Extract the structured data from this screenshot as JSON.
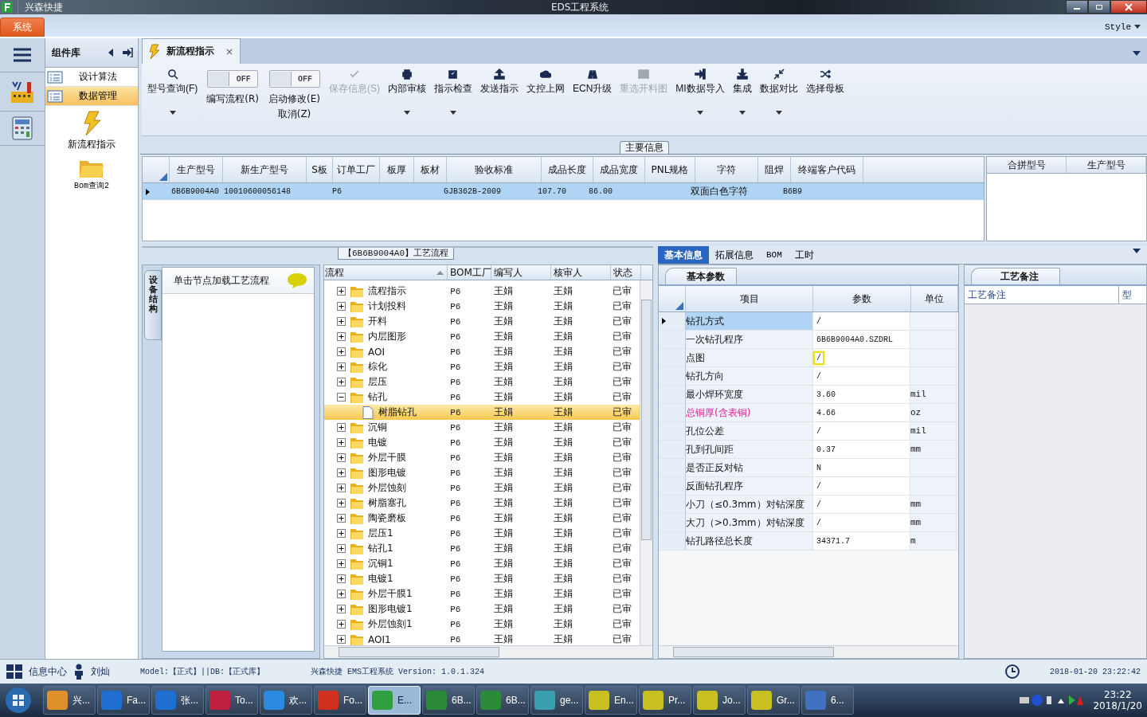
{
  "window": {
    "app_name": "兴森快捷",
    "title": "EDS工程系统"
  },
  "menu": {
    "items": [
      {
        "label": "系统",
        "selected": true
      }
    ],
    "style_label": "Style"
  },
  "nav_strip": {
    "icons": [
      {
        "kind": "menu"
      },
      {
        "kind": "factory"
      },
      {
        "kind": "calculator"
      }
    ]
  },
  "component_panel": {
    "title": "组件库",
    "items": [
      {
        "label": "设计算法",
        "selected": false
      },
      {
        "label": "数据管理",
        "selected": true
      }
    ],
    "tools": [
      {
        "label": "新流程指示",
        "kind": "lightning"
      },
      {
        "label": "Bom查询2",
        "kind": "folder"
      }
    ]
  },
  "document_tab": {
    "label": "新流程指示",
    "close": "×"
  },
  "toolbar": [
    {
      "kind": "button",
      "label": "型号查询(F)",
      "disabled": false,
      "dropdown": true
    },
    {
      "kind": "toggle",
      "state_text": "OFF",
      "on": false,
      "label": "编写流程(R)"
    },
    {
      "kind": "toggle",
      "state_text": "OFF",
      "on": false,
      "label": "启动修改(E)",
      "label2": "取消(Z)"
    },
    {
      "kind": "button",
      "label": "保存信息(S)",
      "disabled": true,
      "dropdown": false
    },
    {
      "kind": "button",
      "label": "内部审核",
      "disabled": false,
      "dropdown": true
    },
    {
      "kind": "button",
      "label": "指示检查",
      "disabled": false,
      "dropdown": true
    },
    {
      "kind": "button",
      "label": "发送指示",
      "disabled": false,
      "dropdown": false
    },
    {
      "kind": "button",
      "label": "文控上网",
      "disabled": false,
      "dropdown": false
    },
    {
      "kind": "button",
      "label": "ECN升级",
      "disabled": false,
      "dropdown": false
    },
    {
      "kind": "button",
      "label": "重选开料图",
      "disabled": true,
      "dropdown": false
    },
    {
      "kind": "button",
      "label": "MI数据导入",
      "disabled": false,
      "dropdown": true
    },
    {
      "kind": "button",
      "label": "集成",
      "disabled": false,
      "dropdown": true
    },
    {
      "kind": "button",
      "label": "数据对比",
      "disabled": false,
      "dropdown": true
    },
    {
      "kind": "button",
      "label": "选择母板",
      "disabled": false,
      "dropdown": false
    }
  ],
  "main_info": {
    "title": "主要信息",
    "columns": [
      "生产型号",
      "新生产型号",
      "S板",
      "订单工厂",
      "板厚",
      "板材",
      "验收标准",
      "成品长度",
      "成品宽度",
      "PNL规格",
      "字符",
      "阻焊",
      "终端客户代码"
    ],
    "rows": [
      {
        "selected": true,
        "cells": [
          "6B6B9004A0",
          "10010600056148",
          "",
          "P6",
          "",
          "",
          "GJB362B-2009",
          "107.70",
          "86.00",
          "",
          "双面白色字符",
          "",
          "B6B9"
        ]
      }
    ],
    "side_columns": [
      "合拼型号",
      "生产型号"
    ]
  },
  "process": {
    "title": "【6B6B9004A0】工艺流程",
    "side_tab": "设备结构",
    "hint": "单击节点加载工艺流程",
    "columns": [
      "流程",
      "BOM工厂",
      "编写人",
      "核审人",
      "状态"
    ],
    "nodes": [
      {
        "label": "流程指示",
        "bom": "P6",
        "writer": "王娟",
        "reviewer": "王娟",
        "status": "已审",
        "expanded": false,
        "selected": false
      },
      {
        "label": "计划投料",
        "bom": "P6",
        "writer": "王娟",
        "reviewer": "王娟",
        "status": "已审",
        "expanded": false,
        "selected": false
      },
      {
        "label": "开料",
        "bom": "P6",
        "writer": "王娟",
        "reviewer": "王娟",
        "status": "已审",
        "expanded": false,
        "selected": false
      },
      {
        "label": "内层图形",
        "bom": "P6",
        "writer": "王娟",
        "reviewer": "王娟",
        "status": "已审",
        "expanded": false,
        "selected": false
      },
      {
        "label": "AOI",
        "bom": "P6",
        "writer": "王娟",
        "reviewer": "王娟",
        "status": "已审",
        "expanded": false,
        "selected": false
      },
      {
        "label": "棕化",
        "bom": "P6",
        "writer": "王娟",
        "reviewer": "王娟",
        "status": "已审",
        "expanded": false,
        "selected": false
      },
      {
        "label": "层压",
        "bom": "P6",
        "writer": "王娟",
        "reviewer": "王娟",
        "status": "已审",
        "expanded": false,
        "selected": false
      },
      {
        "label": "钻孔",
        "bom": "P6",
        "writer": "王娟",
        "reviewer": "王娟",
        "status": "已审",
        "expanded": true,
        "selected": false,
        "children": [
          {
            "label": "树脂钻孔",
            "bom": "P6",
            "writer": "王娟",
            "reviewer": "王娟",
            "status": "已审",
            "selected": true
          }
        ]
      },
      {
        "label": "沉铜",
        "bom": "P6",
        "writer": "王娟",
        "reviewer": "王娟",
        "status": "已审",
        "expanded": false,
        "selected": false
      },
      {
        "label": "电镀",
        "bom": "P6",
        "writer": "王娟",
        "reviewer": "王娟",
        "status": "已审",
        "expanded": false,
        "selected": false
      },
      {
        "label": "外层干膜",
        "bom": "P6",
        "writer": "王娟",
        "reviewer": "王娟",
        "status": "已审",
        "expanded": false,
        "selected": false
      },
      {
        "label": "图形电镀",
        "bom": "P6",
        "writer": "王娟",
        "reviewer": "王娟",
        "status": "已审",
        "expanded": false,
        "selected": false
      },
      {
        "label": "外层蚀刻",
        "bom": "P6",
        "writer": "王娟",
        "reviewer": "王娟",
        "status": "已审",
        "expanded": false,
        "selected": false
      },
      {
        "label": "树脂塞孔",
        "bom": "P6",
        "writer": "王娟",
        "reviewer": "王娟",
        "status": "已审",
        "expanded": false,
        "selected": false
      },
      {
        "label": "陶瓷磨板",
        "bom": "P6",
        "writer": "王娟",
        "reviewer": "王娟",
        "status": "已审",
        "expanded": false,
        "selected": false
      },
      {
        "label": "层压1",
        "bom": "P6",
        "writer": "王娟",
        "reviewer": "王娟",
        "status": "已审",
        "expanded": false,
        "selected": false
      },
      {
        "label": "钻孔1",
        "bom": "P6",
        "writer": "王娟",
        "reviewer": "王娟",
        "status": "已审",
        "expanded": false,
        "selected": false
      },
      {
        "label": "沉铜1",
        "bom": "P6",
        "writer": "王娟",
        "reviewer": "王娟",
        "status": "已审",
        "expanded": false,
        "selected": false
      },
      {
        "label": "电镀1",
        "bom": "P6",
        "writer": "王娟",
        "reviewer": "王娟",
        "status": "已审",
        "expanded": false,
        "selected": false
      },
      {
        "label": "外层干膜1",
        "bom": "P6",
        "writer": "王娟",
        "reviewer": "王娟",
        "status": "已审",
        "expanded": false,
        "selected": false
      },
      {
        "label": "图形电镀1",
        "bom": "P6",
        "writer": "王娟",
        "reviewer": "王娟",
        "status": "已审",
        "expanded": false,
        "selected": false
      },
      {
        "label": "外层蚀刻1",
        "bom": "P6",
        "writer": "王娟",
        "reviewer": "王娟",
        "status": "已审",
        "expanded": false,
        "selected": false
      },
      {
        "label": "AOI1",
        "bom": "P6",
        "writer": "王娟",
        "reviewer": "王娟",
        "status": "已审",
        "expanded": false,
        "selected": false
      }
    ]
  },
  "detail": {
    "tabs": [
      {
        "label": "基本信息",
        "selected": true
      },
      {
        "label": "拓展信息",
        "selected": false
      },
      {
        "label": "BOM",
        "selected": false
      },
      {
        "label": "工时",
        "selected": false
      }
    ],
    "sub_tab": "基本参数",
    "columns": [
      "项目",
      "参数",
      "单位"
    ],
    "rows": [
      {
        "item": "钻孔方式",
        "value": "/",
        "unit": "",
        "selected": true,
        "focused": false,
        "emphasis": false
      },
      {
        "item": "一次钻孔程序",
        "value": "6B6B9004A0.SZDRL",
        "unit": "",
        "selected": false,
        "focused": false,
        "emphasis": false
      },
      {
        "item": "点图",
        "value": "/",
        "unit": "",
        "selected": false,
        "focused": true,
        "emphasis": false
      },
      {
        "item": "钻孔方向",
        "value": "/",
        "unit": "",
        "selected": false,
        "focused": false,
        "emphasis": false
      },
      {
        "item": "最小焊环宽度",
        "value": "3.60",
        "unit": "mil",
        "selected": false,
        "focused": false,
        "emphasis": false
      },
      {
        "item": "总铜厚(含表铜)",
        "value": "4.66",
        "unit": "oz",
        "selected": false,
        "focused": false,
        "emphasis": true
      },
      {
        "item": "孔位公差",
        "value": "/",
        "unit": "mil",
        "selected": false,
        "focused": false,
        "emphasis": false
      },
      {
        "item": "孔到孔间距",
        "value": "0.37",
        "unit": "mm",
        "selected": false,
        "focused": false,
        "emphasis": false
      },
      {
        "item": "是否正反对钻",
        "value": "N",
        "unit": "",
        "selected": false,
        "focused": false,
        "emphasis": false
      },
      {
        "item": "反面钻孔程序",
        "value": "/",
        "unit": "",
        "selected": false,
        "focused": false,
        "emphasis": false
      },
      {
        "item": "小刀（≤0.3mm）对钻深度",
        "value": "/",
        "unit": "mm",
        "selected": false,
        "focused": false,
        "emphasis": false
      },
      {
        "item": "大刀（>0.3mm）对钻深度",
        "value": "/",
        "unit": "mm",
        "selected": false,
        "focused": false,
        "emphasis": false
      },
      {
        "item": "钻孔路径总长度",
        "value": "34371.7",
        "unit": "m",
        "selected": false,
        "focused": false,
        "emphasis": false
      }
    ]
  },
  "notes": {
    "tab": "工艺备注",
    "columns": [
      "工艺备注",
      "型"
    ]
  },
  "status_bar": {
    "info_center": "信息中心",
    "user": "刘灿",
    "model": "Model:【正式】||DB:【正式库】",
    "version": "兴森快捷 EMS工程系统 Version: 1.0.1.324",
    "datetime": "2018-01-20 23:22:42"
  },
  "taskbar": {
    "items": [
      {
        "label": "兴...",
        "color": "#e0902a",
        "selected": false
      },
      {
        "label": "Fa...",
        "color": "#1f6fd0",
        "selected": false
      },
      {
        "label": "张...",
        "color": "#1f6fd0",
        "selected": false
      },
      {
        "label": "To...",
        "color": "#c02040",
        "selected": false
      },
      {
        "label": "欢...",
        "color": "#2a8ae0",
        "selected": false
      },
      {
        "label": "Fo...",
        "color": "#d03020",
        "selected": false
      },
      {
        "label": "E...",
        "color": "#30a040",
        "selected": true
      },
      {
        "label": "6B...",
        "color": "#2a8a3a",
        "selected": false
      },
      {
        "label": "6B...",
        "color": "#2a8a3a",
        "selected": false
      },
      {
        "label": "ge...",
        "color": "#3aa0b0",
        "selected": false
      },
      {
        "label": "En...",
        "color": "#c8c020",
        "selected": false
      },
      {
        "label": "Pr...",
        "color": "#c8c020",
        "selected": false
      },
      {
        "label": "Jo...",
        "color": "#c8c020",
        "selected": false
      },
      {
        "label": "Gr...",
        "color": "#c8c020",
        "selected": false
      },
      {
        "label": "6...",
        "color": "#4070c0",
        "selected": false
      }
    ],
    "time": "23:22",
    "date": "2018/1/20"
  }
}
